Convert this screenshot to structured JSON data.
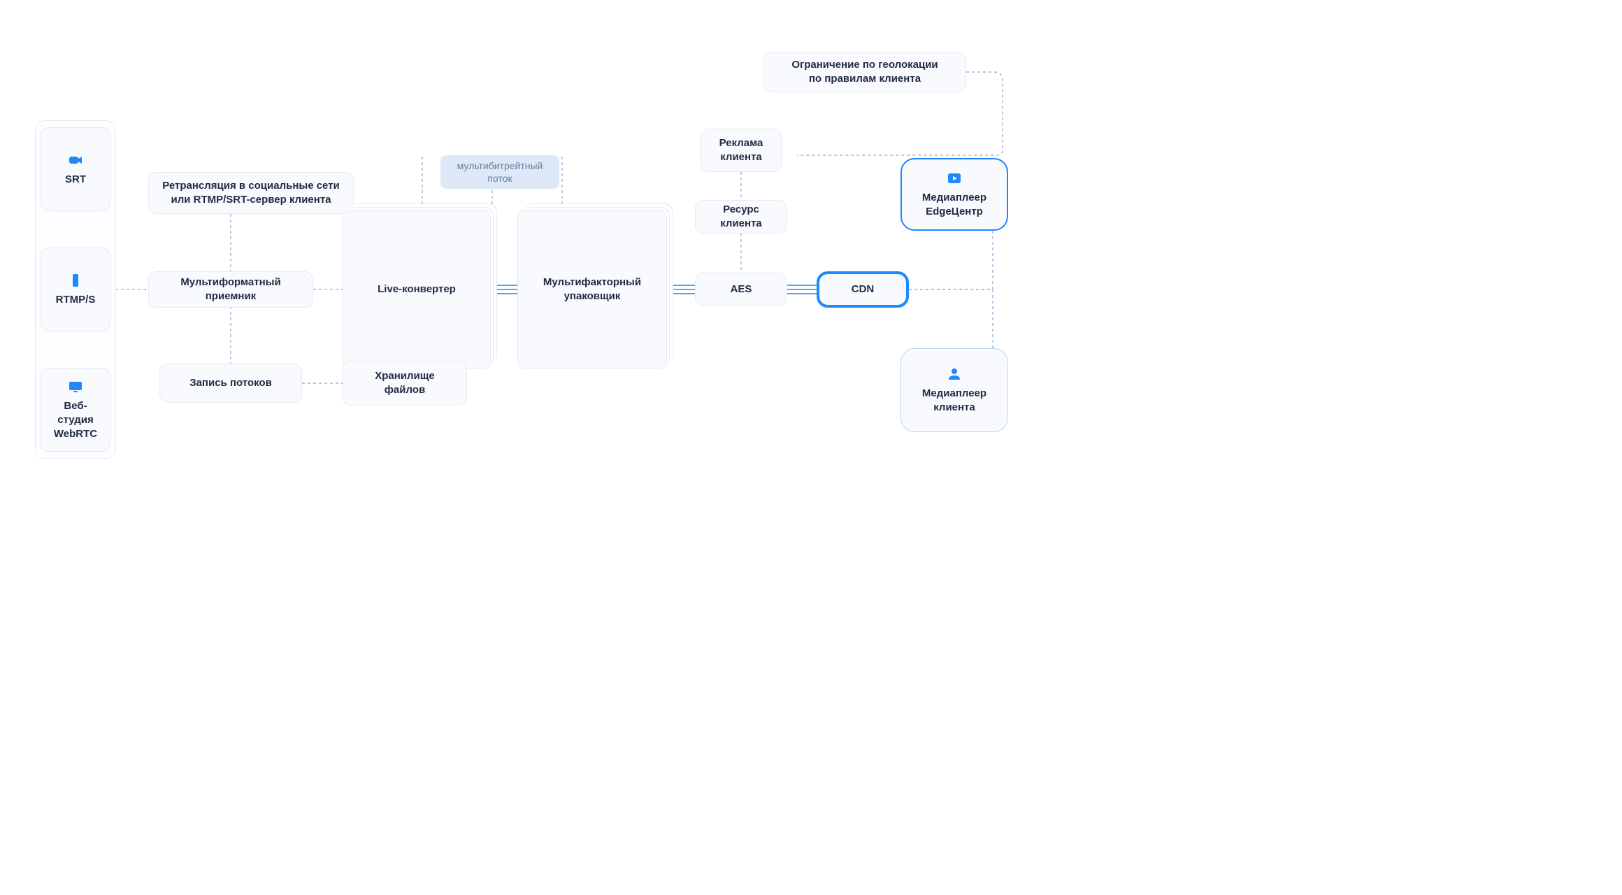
{
  "sidebar": {
    "items": [
      {
        "label": "SRT",
        "icon": "camera-icon"
      },
      {
        "label": "RTMP/S",
        "icon": "phone-icon"
      },
      {
        "label": "Веб-студия\nWebRTC",
        "icon": "monitor-icon"
      }
    ]
  },
  "nodes": {
    "restream": "Ретрансляция в социальные сети\nили RTMP/SRT-сервер клиента",
    "receiver": "Мультиформатный\nприемник",
    "recorder": "Запись потоков",
    "converter": "Live-конвертер",
    "storage": "Хранилище\nфайлов",
    "packager": "Мультифакторный\nупаковщик",
    "aes": "AES",
    "cdn": "CDN",
    "resource": "Ресурс клиента",
    "ads": "Реклама\nклиента",
    "geo": "Ограничение по геолокации\nпо правилам клиента",
    "player_edge": "Медиаплеер\nEdgeЦентр",
    "player_client": "Медиаплеер\nклиента"
  },
  "labels": {
    "multibitrate": "мультибитрейтный\nпоток"
  }
}
